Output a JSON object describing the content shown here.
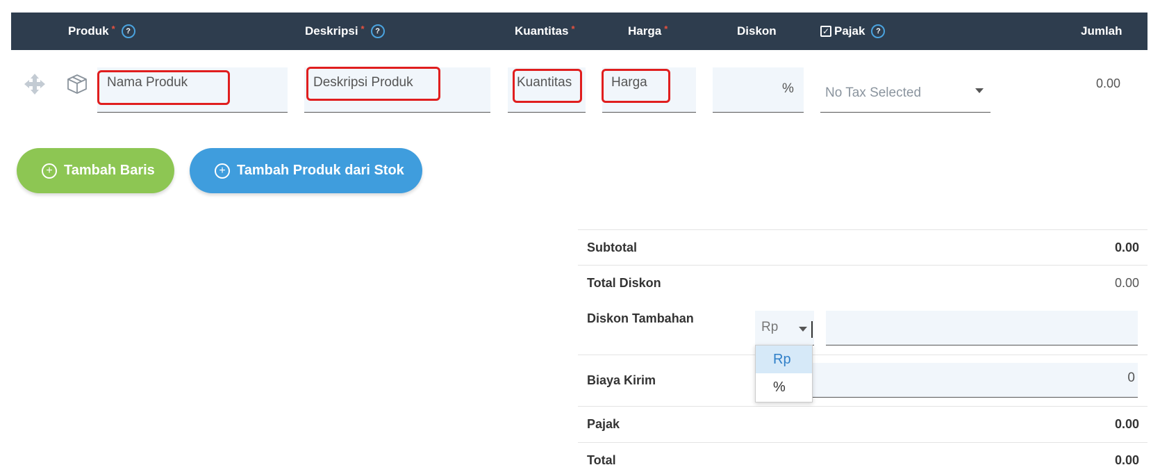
{
  "header": {
    "produk": "Produk",
    "deskripsi": "Deskripsi",
    "kuantitas": "Kuantitas",
    "harga": "Harga",
    "diskon": "Diskon",
    "pajak": "Pajak",
    "jumlah": "Jumlah",
    "required_mark": "*",
    "help_mark": "?"
  },
  "row": {
    "produk_placeholder": "Nama Produk",
    "deskripsi_placeholder": "Deskripsi Produk",
    "kuantitas_placeholder": "Kuantitas",
    "harga_placeholder": "Harga",
    "diskon_unit": "%",
    "tax_placeholder": "No Tax Selected",
    "jumlah": "0.00"
  },
  "buttons": {
    "tambah_baris": "Tambah Baris",
    "tambah_produk": "Tambah Produk dari Stok"
  },
  "summary": {
    "subtotal_label": "Subtotal",
    "subtotal_value": "0.00",
    "total_diskon_label": "Total Diskon",
    "total_diskon_value": "0.00",
    "diskon_tambahan_label": "Diskon Tambahan",
    "diskon_tambahan_type": "Rp",
    "diskon_options": [
      "Rp",
      "%"
    ],
    "biaya_kirim_label": "Biaya Kirim",
    "biaya_kirim_value": "0",
    "pajak_label": "Pajak",
    "pajak_value": "0.00",
    "total_label": "Total",
    "total_value": "0.00"
  },
  "colors": {
    "header_bg": "#2e3d4e",
    "required": "#e8513f",
    "help": "#4aa3df",
    "btn_green": "#8dc653",
    "btn_blue": "#3f9ddd",
    "highlight": "#e01e1e",
    "field_bg": "#f1f6fb"
  }
}
